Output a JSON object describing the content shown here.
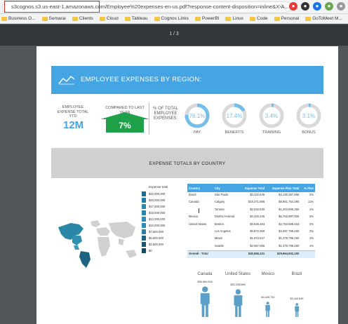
{
  "browser": {
    "url": "s3cognos.s3.us-east-1.amazonaws.com/Employee%20expenses-en-us.pdf?response-content-disposition=inline&X-A...",
    "bookmarks": [
      "Business O...",
      "Semarai",
      "Clients",
      "Cloud",
      "Tableau",
      "Cognos Links",
      "PowerBI",
      "Linux",
      "Code",
      "Personal",
      "GoToMeet M..."
    ]
  },
  "pdf_toolbar": {
    "page_indicator": "1 / 3"
  },
  "report": {
    "title": "EMPLOYEE EXPENSES BY REGION:",
    "kpis": {
      "total_label": "EMPLOYEE EXPENSE TOTAL YTD",
      "total_value": "12M",
      "compare_label": "COMPARED TO LAST YEAR",
      "compare_value": "7%",
      "pct_label": "% OF TOTAL EMPLOYEE EXPENSES:"
    },
    "donuts": [
      {
        "value": "76.1%",
        "label": "PAY",
        "fraction": 0.761
      },
      {
        "value": "17.4%",
        "label": "BENEFITS",
        "fraction": 0.174
      },
      {
        "value": "3.4%",
        "label": "TRAINING",
        "fraction": 0.034
      },
      {
        "value": "3.1%",
        "label": "BONUS",
        "fraction": 0.031
      }
    ],
    "section_title": "EXPENSE TOTALS BY COUNTRY",
    "legend_title": "Expense total",
    "legend": [
      {
        "label": "$22,000,000",
        "color": "#1d6f8f"
      },
      {
        "label": "$20,000,000",
        "color": "#227c9d"
      },
      {
        "label": "$17,000,000",
        "color": "#2a87a8"
      },
      {
        "label": "$15,000,000",
        "color": "#2a87a8"
      },
      {
        "label": "$12,000,000",
        "color": "#2f8fb0"
      },
      {
        "label": "$10,000,000",
        "color": "#2f8fb0"
      },
      {
        "label": "$7,500,000",
        "color": "#2a80a0"
      },
      {
        "label": "$5,000,000",
        "color": "#1d6480"
      },
      {
        "label": "$2,500,000",
        "color": "#1a5670"
      },
      {
        "label": "$0",
        "color": "#17475c"
      }
    ],
    "table": {
      "headers": [
        "Country",
        "City",
        "Expense Total",
        "Expense Plan Total",
        "% Plan"
      ],
      "rows": [
        [
          "Brazil",
          "São Paulo",
          "$3,442,645",
          "$4,130,397,666",
          "2%"
        ],
        [
          "Canada",
          "Calgary",
          "$18,371,886",
          "$8,861,754,290",
          "11%"
        ],
        [
          "",
          "Toronto",
          "$2,032,530",
          "$1,204,695,350",
          "1%"
        ],
        [
          "Mexico",
          "Distrito Federal",
          "$4,320,246",
          "$5,762,997,000",
          "3%"
        ],
        [
          "United States",
          "Boston",
          "$3,626,463",
          "$2,753,588,403",
          "2%"
        ],
        [
          "",
          "Los Angeles",
          "$3,872,659",
          "$3,097,798,250",
          "2%"
        ],
        [
          "",
          "Miami",
          "$1,972,547",
          "$1,378,796,250",
          "1%"
        ],
        [
          "",
          "Seattle",
          "$2,067,066",
          "$1,378,796,250",
          "1%"
        ]
      ],
      "total": [
        "Overall - Total",
        "",
        "$40,556,101",
        "$29,664,602,190",
        ""
      ]
    },
    "countries": [
      {
        "name": "Canada",
        "value": "$36,464,528"
      },
      {
        "name": "United States",
        "value": "$32,228,688"
      },
      {
        "name": "Mexico",
        "value": "$4,326,740"
      },
      {
        "name": "Brazil",
        "value": "$3,442,645"
      }
    ]
  }
}
